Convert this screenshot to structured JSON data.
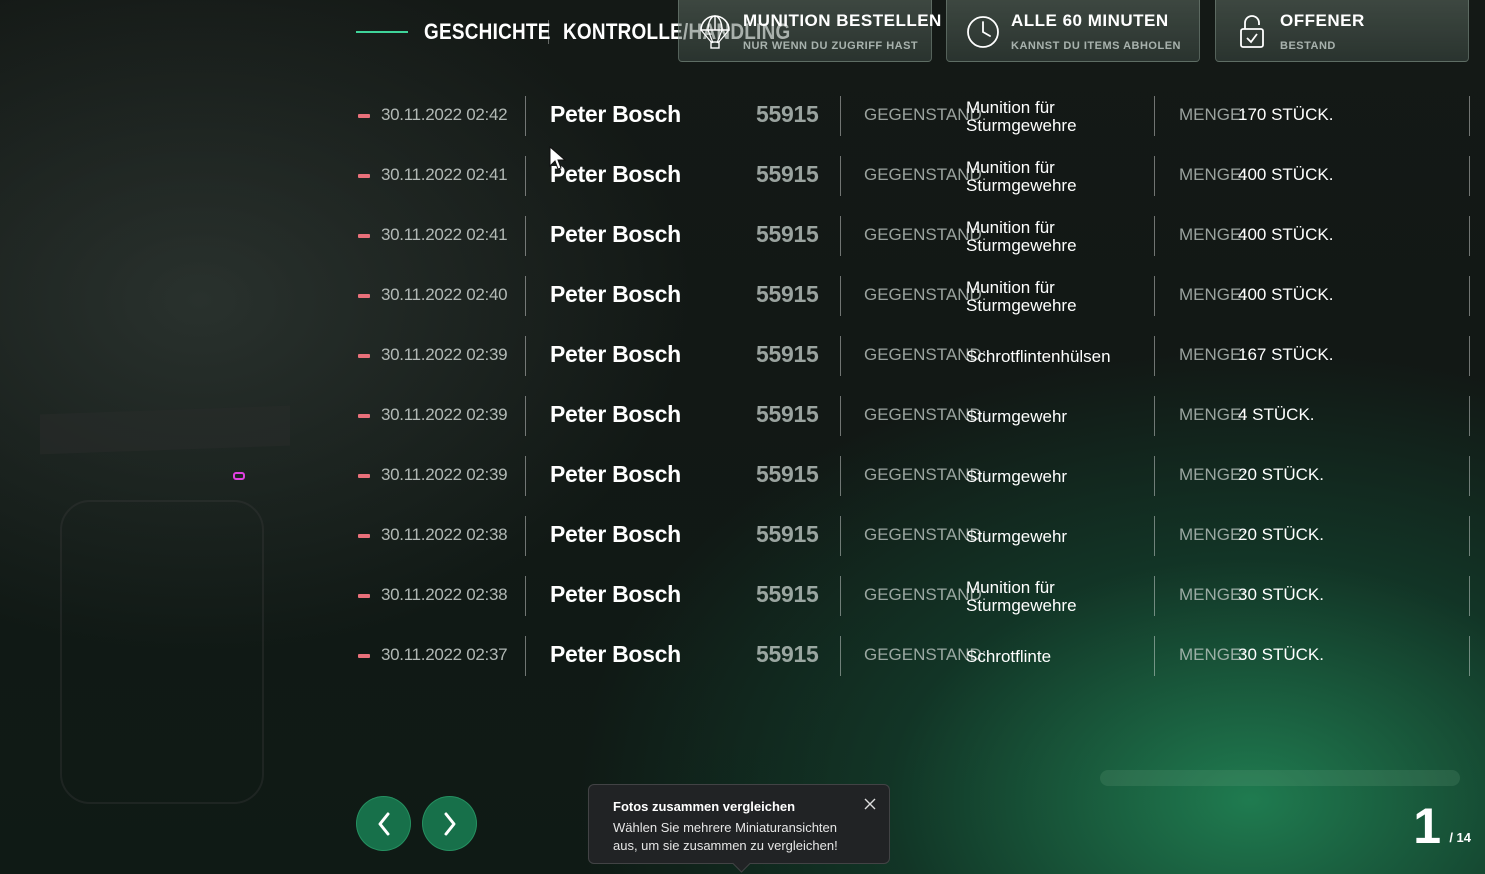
{
  "tabs": [
    {
      "label": "GESCHICHTE",
      "active": true
    },
    {
      "label": "KONTROLLE/HANDLING",
      "active": false
    }
  ],
  "cards": [
    {
      "title": "MUNITION BESTELLEN",
      "subtitle": "NUR WENN DU ZUGRIFF HAST",
      "icon": "parachute-icon"
    },
    {
      "title": "ALLE 60 MINUTEN",
      "subtitle": "KANNST DU ITEMS ABHOLEN",
      "icon": "clock-icon"
    },
    {
      "title": "OFFENER",
      "subtitle": "BESTAND",
      "icon": "unlock-icon"
    }
  ],
  "labels": {
    "item": "GEGENSTAND:",
    "quantity": "MENGE:"
  },
  "rows": [
    {
      "date": "30.11.2022 02:42",
      "name": "Peter Bosch",
      "id": "55915",
      "item": "Munition für Sturmgewehre",
      "qty": "170 STÜCK."
    },
    {
      "date": "30.11.2022 02:41",
      "name": "Peter Bosch",
      "id": "55915",
      "item": "Munition für Sturmgewehre",
      "qty": "400 STÜCK."
    },
    {
      "date": "30.11.2022 02:41",
      "name": "Peter Bosch",
      "id": "55915",
      "item": "Munition für Sturmgewehre",
      "qty": "400 STÜCK."
    },
    {
      "date": "30.11.2022 02:40",
      "name": "Peter Bosch",
      "id": "55915",
      "item": "Munition für Sturmgewehre",
      "qty": "400 STÜCK."
    },
    {
      "date": "30.11.2022 02:39",
      "name": "Peter Bosch",
      "id": "55915",
      "item": "Schrotflintenhülsen",
      "qty": "167 STÜCK."
    },
    {
      "date": "30.11.2022 02:39",
      "name": "Peter Bosch",
      "id": "55915",
      "item": "Sturmgewehr",
      "qty": "4 STÜCK."
    },
    {
      "date": "30.11.2022 02:39",
      "name": "Peter Bosch",
      "id": "55915",
      "item": "Sturmgewehr",
      "qty": "20 STÜCK."
    },
    {
      "date": "30.11.2022 02:38",
      "name": "Peter Bosch",
      "id": "55915",
      "item": "Sturmgewehr",
      "qty": "20 STÜCK."
    },
    {
      "date": "30.11.2022 02:38",
      "name": "Peter Bosch",
      "id": "55915",
      "item": "Munition für Sturmgewehre",
      "qty": "30 STÜCK."
    },
    {
      "date": "30.11.2022 02:37",
      "name": "Peter Bosch",
      "id": "55915",
      "item": "Schrotflinte",
      "qty": "30 STÜCK."
    }
  ],
  "pagination": {
    "current": "1",
    "total": "/ 14"
  },
  "toast": {
    "title": "Fotos zusammen vergleichen",
    "body": "Wählen Sie mehrere Miniaturansichten aus, um sie zusammen zu vergleichen!"
  },
  "colors": {
    "accent": "#3fd49a",
    "button": "#17704a",
    "minus": "#e8707a"
  }
}
